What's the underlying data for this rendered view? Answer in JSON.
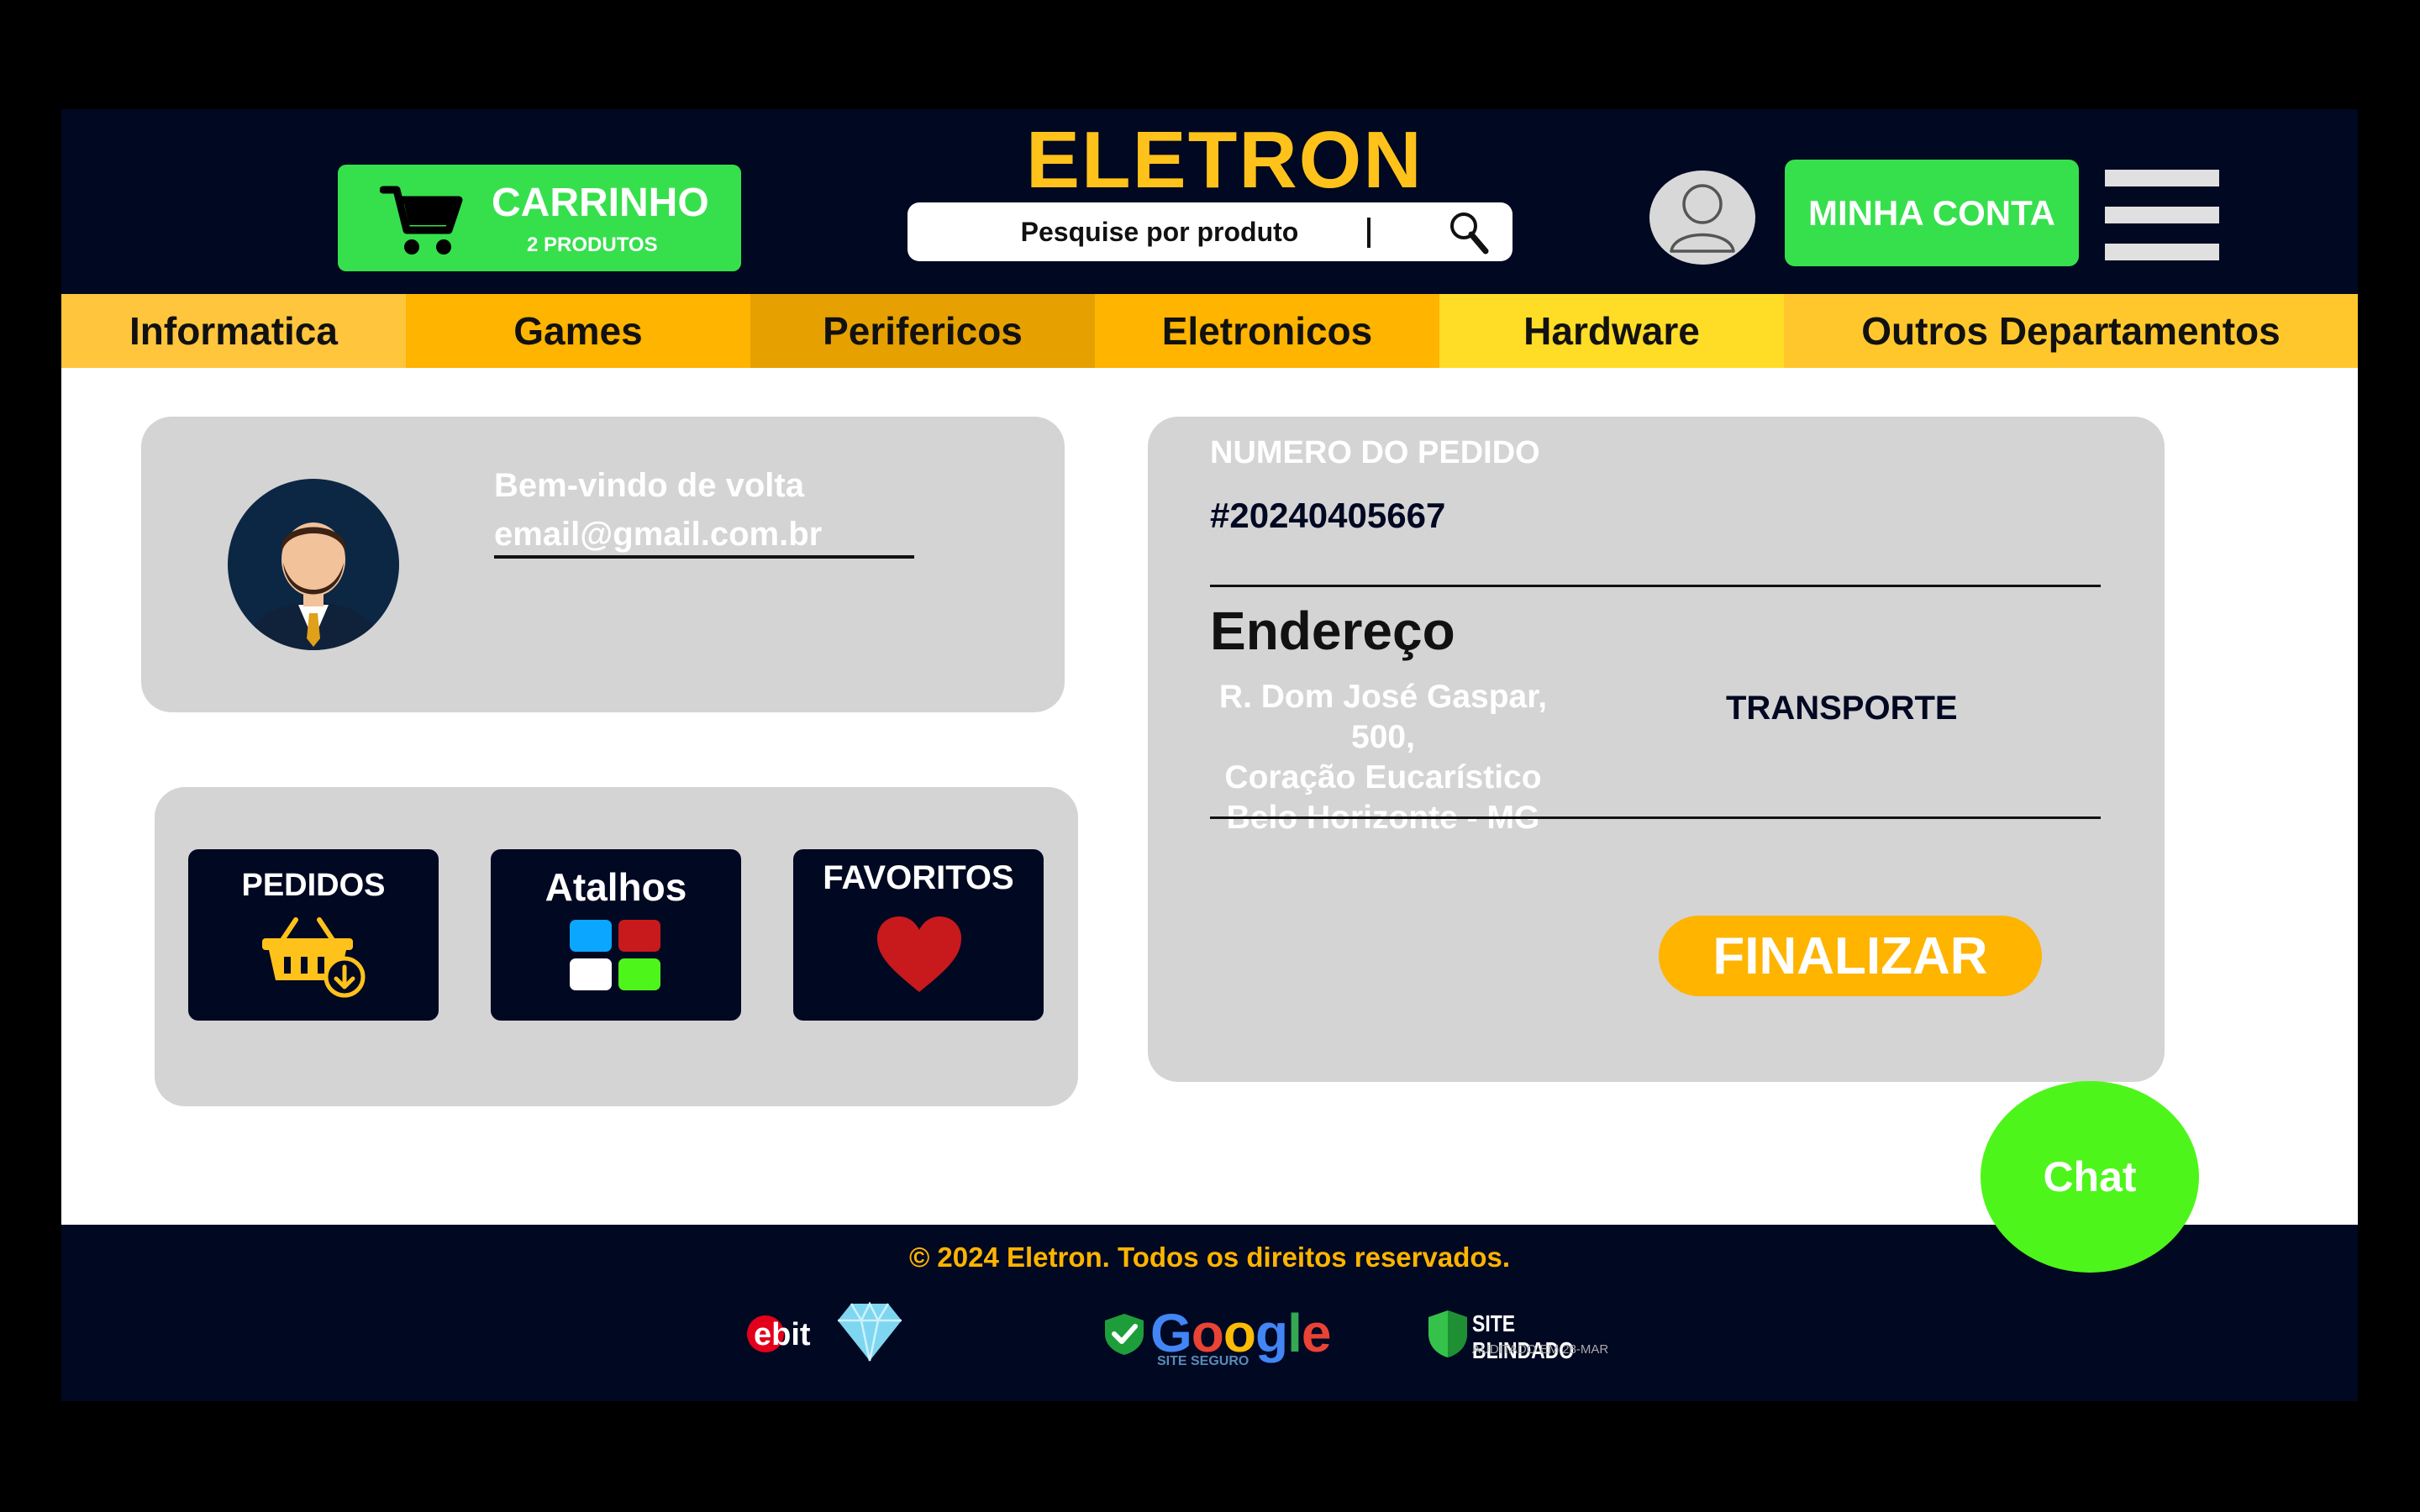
{
  "header": {
    "cart": {
      "title": "CARRINHO",
      "subtitle": "2 PRODUTOS",
      "icon": "cart-icon"
    },
    "logo": "ELETRON",
    "search": {
      "placeholder": "Pesquise por produto",
      "value": "",
      "icon": "search-icon"
    },
    "account_label": "MINHA CONTA",
    "menu_icon": "hamburger-menu-icon",
    "avatar_icon": "user-avatar-icon"
  },
  "nav": {
    "items": [
      {
        "label": "Informatica",
        "color": "#ffc53d"
      },
      {
        "label": "Games",
        "color": "#ffb400"
      },
      {
        "label": "Perifericos",
        "color": "#e6a100"
      },
      {
        "label": "Eletronicos",
        "color": "#ffb400"
      },
      {
        "label": "Hardware",
        "color": "#ffdc26"
      },
      {
        "label": "Outros Departamentos",
        "color": "#ffc72c"
      }
    ]
  },
  "profile": {
    "welcome": "Bem-vindo de volta",
    "email": "email@gmail.com.br"
  },
  "shortcuts": {
    "items": [
      {
        "label": "PEDIDOS",
        "icon": "basket-download-icon"
      },
      {
        "label": "Atalhos",
        "icon": "grid-shortcuts-icon"
      },
      {
        "label": "FAVORITOS",
        "icon": "heart-icon"
      }
    ]
  },
  "order": {
    "number_label": "NUMERO DO PEDIDO",
    "number": "#20240405667",
    "address_title": "Endereço",
    "address_lines": [
      "R. Dom José Gaspar, 500,",
      "Coração Eucarístico",
      "Belo Horizonte - MG"
    ],
    "transport_label": "TRANSPORTE",
    "finalize_label": "FINALIZAR"
  },
  "chat_label": "Chat",
  "footer": {
    "copyright": "© 2024 Eletron. Todos os direitos reservados.",
    "badges": {
      "ebit": {
        "text": "ebit",
        "icon": "diamond-icon"
      },
      "google": {
        "text": "Google",
        "sub": "SITE SEGURO",
        "icon": "check-shield-icon"
      },
      "blindado": {
        "text": "SITE BLINDADO",
        "sub": "AUDITADO EM 28-MAR",
        "icon": "shield-icon"
      }
    }
  },
  "colors": {
    "navy": "#010822",
    "green": "#36e04c",
    "yellow": "#ffc21a",
    "orange": "#ffb400",
    "card_gray": "#d4d4d4",
    "chat_green": "#4ef51a"
  }
}
